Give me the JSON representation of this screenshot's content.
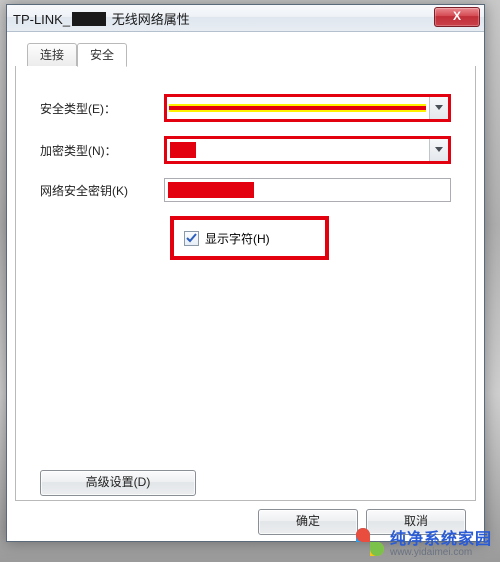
{
  "window": {
    "title_prefix": "TP-LINK_",
    "title_suffix": " 无线网络属性",
    "close_glyph": "X"
  },
  "tabs": {
    "connect": "连接",
    "security": "安全"
  },
  "labels": {
    "security_type": "安全类型(E)：",
    "encryption_type": "加密类型(N)：",
    "network_key": "网络安全密钥(K)",
    "show_chars": "显示字符(H)"
  },
  "buttons": {
    "advanced": "高级设置(D)",
    "ok": "确定",
    "cancel": "取消"
  },
  "values": {
    "security_type": "",
    "encryption_type": "",
    "network_key": "",
    "show_chars_checked": true
  },
  "watermark": {
    "cn": "纯净系统家园",
    "en": "www.yidaimei.com"
  }
}
